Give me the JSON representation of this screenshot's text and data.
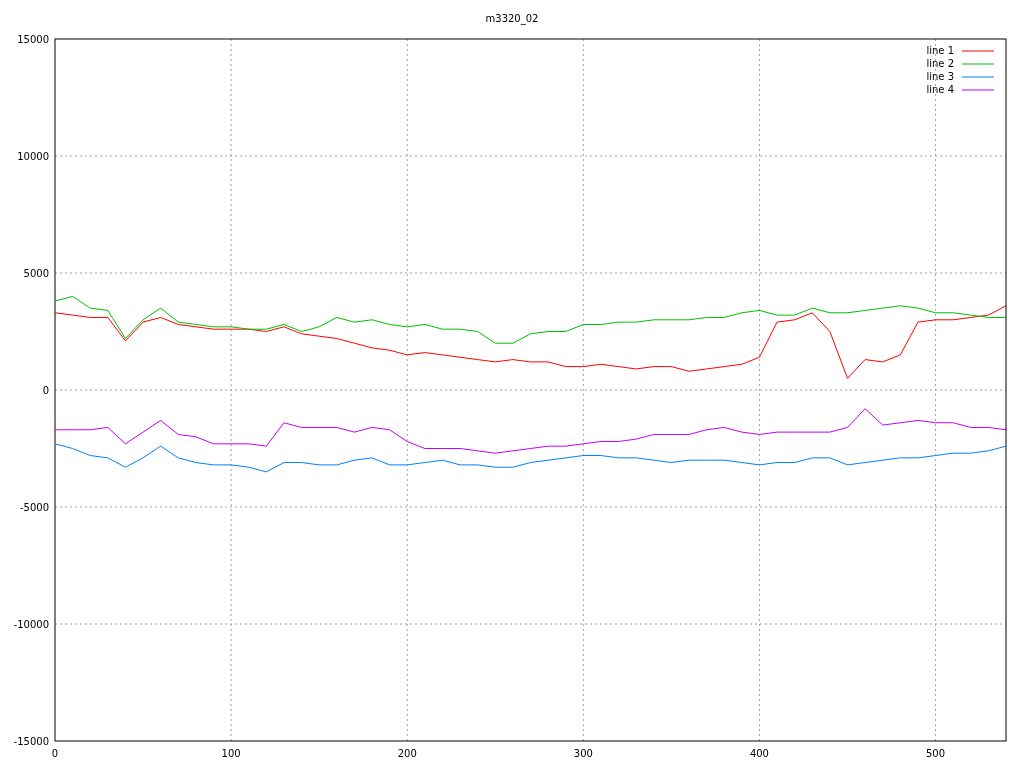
{
  "chart_data": {
    "type": "line",
    "title": "m3320_02",
    "x": [
      0,
      10,
      20,
      30,
      40,
      50,
      60,
      70,
      80,
      90,
      100,
      110,
      120,
      130,
      140,
      150,
      160,
      170,
      180,
      190,
      200,
      210,
      220,
      230,
      240,
      250,
      260,
      270,
      280,
      290,
      300,
      310,
      320,
      330,
      340,
      350,
      360,
      370,
      380,
      390,
      400,
      410,
      420,
      430,
      440,
      450,
      460,
      470,
      480,
      490,
      500,
      510,
      520,
      530,
      540
    ],
    "series": [
      {
        "name": "line 1",
        "color": "#ff0000",
        "values": [
          3300,
          3200,
          3100,
          3100,
          2100,
          2900,
          3100,
          2800,
          2700,
          2600,
          2600,
          2600,
          2500,
          2700,
          2400,
          2300,
          2200,
          2000,
          1800,
          1700,
          1500,
          1600,
          1500,
          1400,
          1300,
          1200,
          1300,
          1200,
          1200,
          1000,
          1000,
          1100,
          1000,
          900,
          1000,
          1000,
          800,
          900,
          1000,
          1100,
          1400,
          2900,
          3000,
          3300,
          2500,
          500,
          1300,
          1200,
          1500,
          2900,
          3000,
          3000,
          3100,
          3200,
          3600
        ]
      },
      {
        "name": "line 2",
        "color": "#00c000",
        "values": [
          3800,
          4000,
          3500,
          3400,
          2200,
          3000,
          3500,
          2900,
          2800,
          2700,
          2700,
          2600,
          2600,
          2800,
          2500,
          2700,
          3100,
          2900,
          3000,
          2800,
          2700,
          2800,
          2600,
          2600,
          2500,
          2000,
          2000,
          2400,
          2500,
          2500,
          2800,
          2800,
          2900,
          2900,
          3000,
          3000,
          3000,
          3100,
          3100,
          3300,
          3400,
          3200,
          3200,
          3500,
          3300,
          3300,
          3400,
          3500,
          3600,
          3500,
          3300,
          3300,
          3200,
          3100,
          3100
        ]
      },
      {
        "name": "line 3",
        "color": "#0080ff",
        "values": [
          -2300,
          -2500,
          -2800,
          -2900,
          -3300,
          -2900,
          -2400,
          -2900,
          -3100,
          -3200,
          -3200,
          -3300,
          -3500,
          -3100,
          -3100,
          -3200,
          -3200,
          -3000,
          -2900,
          -3200,
          -3200,
          -3100,
          -3000,
          -3200,
          -3200,
          -3300,
          -3300,
          -3100,
          -3000,
          -2900,
          -2800,
          -2800,
          -2900,
          -2900,
          -3000,
          -3100,
          -3000,
          -3000,
          -3000,
          -3100,
          -3200,
          -3100,
          -3100,
          -2900,
          -2900,
          -3200,
          -3100,
          -3000,
          -2900,
          -2900,
          -2800,
          -2700,
          -2700,
          -2600,
          -2400
        ]
      },
      {
        "name": "line 4",
        "color": "#c000ff",
        "values": [
          -1700,
          -1700,
          -1700,
          -1600,
          -2300,
          -1800,
          -1300,
          -1900,
          -2000,
          -2300,
          -2300,
          -2300,
          -2400,
          -1400,
          -1600,
          -1600,
          -1600,
          -1800,
          -1600,
          -1700,
          -2200,
          -2500,
          -2500,
          -2500,
          -2600,
          -2700,
          -2600,
          -2500,
          -2400,
          -2400,
          -2300,
          -2200,
          -2200,
          -2100,
          -1900,
          -1900,
          -1900,
          -1700,
          -1600,
          -1800,
          -1900,
          -1800,
          -1800,
          -1800,
          -1800,
          -1600,
          -800,
          -1500,
          -1400,
          -1300,
          -1400,
          -1400,
          -1600,
          -1600,
          -1700
        ]
      }
    ],
    "xlim": [
      0,
      540
    ],
    "ylim": [
      -15000,
      15000
    ],
    "xticks": [
      0,
      100,
      200,
      300,
      400,
      500
    ],
    "yticks": [
      -15000,
      -10000,
      -5000,
      0,
      5000,
      10000,
      15000
    ],
    "grid": true,
    "legend": true
  }
}
